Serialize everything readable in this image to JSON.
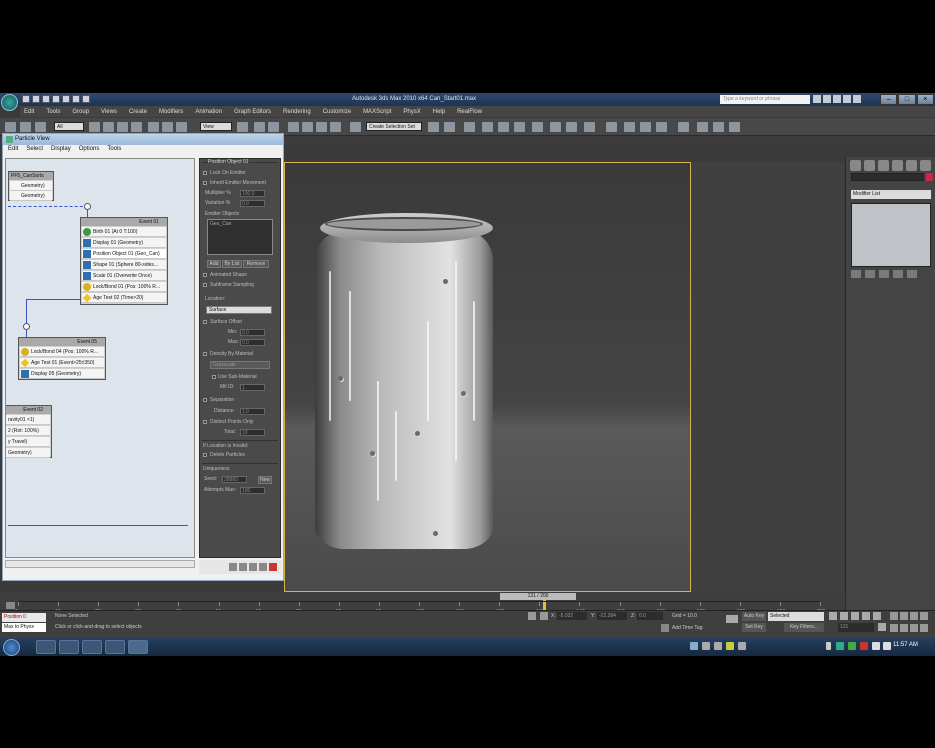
{
  "window": {
    "title": "Autodesk 3ds Max 2010 x64   Can_Start01.max",
    "search_placeholder": "Type a keyword or phrase"
  },
  "menubar": [
    "Edit",
    "Tools",
    "Group",
    "Views",
    "Create",
    "Modifiers",
    "Animation",
    "Graph Editors",
    "Rendering",
    "Customize",
    "MAXScript",
    "PhysX",
    "Help",
    "RealFlow"
  ],
  "toolbar": {
    "selection_filter": "All",
    "ref_coord": "View",
    "named_selection": "Create Selection Set"
  },
  "particle_view": {
    "title": "Particle View",
    "menu": [
      "Edit",
      "Select",
      "Display",
      "Options",
      "Tools"
    ],
    "source": {
      "title": "PF5_CanSorts",
      "rows": [
        "Geometry)",
        "Geometry)"
      ]
    },
    "event01": {
      "title": "Event 01",
      "rows": [
        "Birth 01 (At 0 T:100)",
        "Display 01 (Geometry)",
        "Position Object 01 (Geo_Can)",
        "Shape 01 (Sphere 80-sides...",
        "Scale 01 (Overwrite Once)",
        "Lock/Bond 01 (Pos: 100% R...",
        "Age Test 02 (Time>20)"
      ]
    },
    "event05": {
      "title": "Event 05",
      "rows": [
        "Lock/Bond 04 (Pos: 100% R...",
        "Age Test 01 (Event>25±350)",
        "Display 05 (Geometry)"
      ]
    },
    "event02": {
      "title": "Event 02",
      "rows": [
        "ravity01 ×1)",
        "2 (Rot: 100%)",
        "y Travel)",
        "Geometry)"
      ]
    },
    "params": {
      "rollout_title": "Position Object 01",
      "lock_on_emitter": "Lock On Emitter",
      "inherit_emitter_movement": "Inherit Emitter Movement",
      "multiplier_label": "Multiplier %",
      "multiplier_value": "100.0",
      "variation_label": "Variation %",
      "variation_value": "0.0",
      "emitter_objects_label": "Emitter Objects",
      "emitter_object": "Geo_Can",
      "add_label": "Add",
      "bylist_label": "By List",
      "remove_label": "Remove",
      "animated_shape": "Animated Shape",
      "subframe_sampling": "Subframe Sampling",
      "location_label": "Location:",
      "location_value": "Surface",
      "surface_offset": "Surface Offset",
      "min_label": "Min:",
      "min_value": "0.0",
      "max_label": "Max:",
      "max_value": "0.0",
      "density_by_material": "Density By Material",
      "density_mode": "Grayscale",
      "use_sub_material": "Use Sub-Material",
      "mtl_id_label": "Mtl ID:",
      "mtl_id_value": "1",
      "separation": "Separation",
      "distance_label": "Distance:",
      "distance_value": "1.0",
      "distinct_points_only": "Distinct Points Only",
      "total_label": "Total:",
      "total_value": "10",
      "if_invalid_label": "If Location is Invalid:",
      "delete_particles": "Delete Particles",
      "uniqueness_label": "Uniqueness",
      "seed_label": "Seed:",
      "seed_value": "28883",
      "new_label": "New",
      "attempts_label": "Attempts Max:",
      "attempts_value": "100"
    }
  },
  "command_panel": {
    "modifier_list": "Modifier List"
  },
  "timeline": {
    "slider_label": "131 / 200",
    "ticks": [
      "0",
      "10",
      "20",
      "30",
      "40",
      "50",
      "60",
      "70",
      "80",
      "90",
      "100",
      "110",
      "120",
      "130",
      "140",
      "150",
      "160",
      "170",
      "180",
      "190",
      "200"
    ]
  },
  "status": {
    "script_line1": "Position 0",
    "script_line2": "Max to Physx",
    "selection": "None Selected",
    "prompt": "Click or click-and-drag to select objects",
    "x_label": "X:",
    "x_value": "-5.032",
    "y_label": "Y:",
    "y_value": "-22.284",
    "z_label": "Z:",
    "z_value": "0.0",
    "grid": "Grid = 10.0",
    "add_time_tag": "Add Time Tag",
    "auto_key": "Auto Key",
    "set_key": "Set Key",
    "selected_dropdown": "Selected",
    "key_filters": "Key Filters...",
    "frame_field": "131"
  },
  "taskbar": {
    "clock": "11:57 AM"
  },
  "colors": {
    "viewport_border": "#d7b34a",
    "wire": "#3b56c4",
    "object_color": "#c8284a"
  }
}
